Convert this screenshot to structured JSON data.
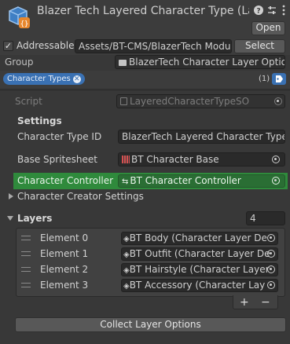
{
  "header": {
    "title": "Blazer Tech Layered Character Type (Layere",
    "asset_icon": "scriptable-object-icon",
    "help_icon": "help-icon",
    "settings_icon": "sliders-icon",
    "menu_icon": "kebab-menu-icon",
    "open_label": "Open"
  },
  "addressable": {
    "checked": true,
    "label": "Addressable",
    "path": "Assets/BT-CMS/BlazerTech Modula",
    "select_label": "Select"
  },
  "group": {
    "label": "Group",
    "value": "BlazerTech Character Layer Optio"
  },
  "labels": {
    "chip": "Character Types",
    "count": "(1)",
    "tag_icon": "tag-icon"
  },
  "inspector": {
    "script_label": "Script",
    "script_value": "LayeredCharacterTypeSO",
    "settings_title": "Settings",
    "character_type_id_label": "Character Type ID",
    "character_type_id_value": "BlazerTech Layered Character Type",
    "base_spritesheet_label": "Base Spritesheet",
    "base_spritesheet_value": "BT Character Base",
    "character_controller_label": "Character Controller",
    "character_controller_value": "BT Character Controller",
    "creator_settings_label": "Character Creator Settings",
    "highlight_color": "#2f8a3c"
  },
  "layers": {
    "label": "Layers",
    "count": "4",
    "elements": [
      {
        "label": "Element 0",
        "value": "BT Body (Character Layer De"
      },
      {
        "label": "Element 1",
        "value": "BT Outfit (Character Layer De"
      },
      {
        "label": "Element 2",
        "value": "BT Hairstyle (Character Layer"
      },
      {
        "label": "Element 3",
        "value": "BT Accessory (Character Lay"
      }
    ],
    "add_label": "+",
    "remove_label": "−"
  },
  "collect_label": "Collect Layer Options"
}
